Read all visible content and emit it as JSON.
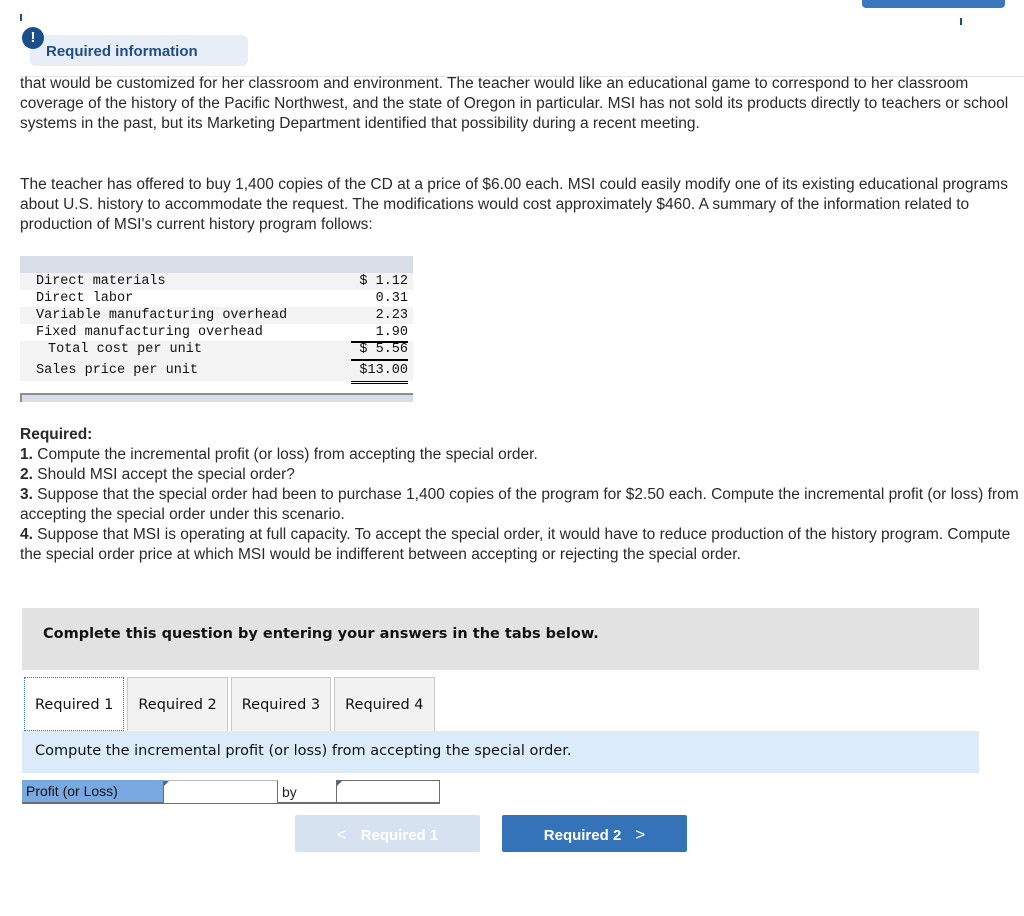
{
  "header": {
    "alert_icon_glyph": "!",
    "required_info_label": "Required information"
  },
  "paragraphs": [
    "that would be customized for her classroom and environment. The teacher would like an educational game to correspond to her classroom coverage of the history of the Pacific Northwest, and the state of Oregon in particular. MSI has not sold its products directly to teachers or school systems in the past, but its Marketing Department identified that possibility during a recent meeting.",
    "The teacher has offered to buy 1,400 copies of the CD at a price of $6.00 each. MSI could easily modify one of its existing educational programs about U.S. history to accommodate the request. The modifications would cost approximately $460. A summary of the information related to production of MSI's current history program follows:"
  ],
  "cost_table": {
    "rows": [
      {
        "label": "Direct materials",
        "value": "$ 1.12"
      },
      {
        "label": "Direct labor",
        "value": "0.31"
      },
      {
        "label": "Variable manufacturing overhead",
        "value": "2.23"
      },
      {
        "label": "Fixed manufacturing overhead",
        "value": "1.90"
      },
      {
        "label": "Total cost per unit",
        "value": "$ 5.56"
      },
      {
        "label": "Sales price per unit",
        "value": "$13.00"
      }
    ]
  },
  "required": {
    "title": "Required:",
    "items": [
      {
        "num": "1.",
        "text": " Compute the incremental profit (or loss) from accepting the special order."
      },
      {
        "num": "2.",
        "text": " Should MSI accept the special order?"
      },
      {
        "num": "3.",
        "text": " Suppose that the special order had been to purchase 1,400 copies of the program for $2.50 each. Compute the incremental profit (or loss) from accepting the special order under this scenario."
      },
      {
        "num": "4.",
        "text": " Suppose that MSI is operating at full capacity. To accept the special order, it would have to reduce production of the history program. Compute the special order price at which MSI would be indifferent between accepting or rejecting the special order."
      }
    ]
  },
  "instructions": "Complete this question by entering your answers in the tabs below.",
  "tabs": [
    {
      "label": "Required 1",
      "active": true
    },
    {
      "label": "Required 2",
      "active": false
    },
    {
      "label": "Required 3",
      "active": false
    },
    {
      "label": "Required 4",
      "active": false
    }
  ],
  "tab_panel": {
    "prompt": "Compute the incremental profit (or loss) from accepting the special order.",
    "answer_label": "Profit (or Loss)",
    "answer_value": "",
    "by_label": "by",
    "by_value": ""
  },
  "navigation": {
    "prev_label": "Required 1",
    "next_label": "Required 2",
    "prev_chevron": "<",
    "next_chevron": ">"
  }
}
